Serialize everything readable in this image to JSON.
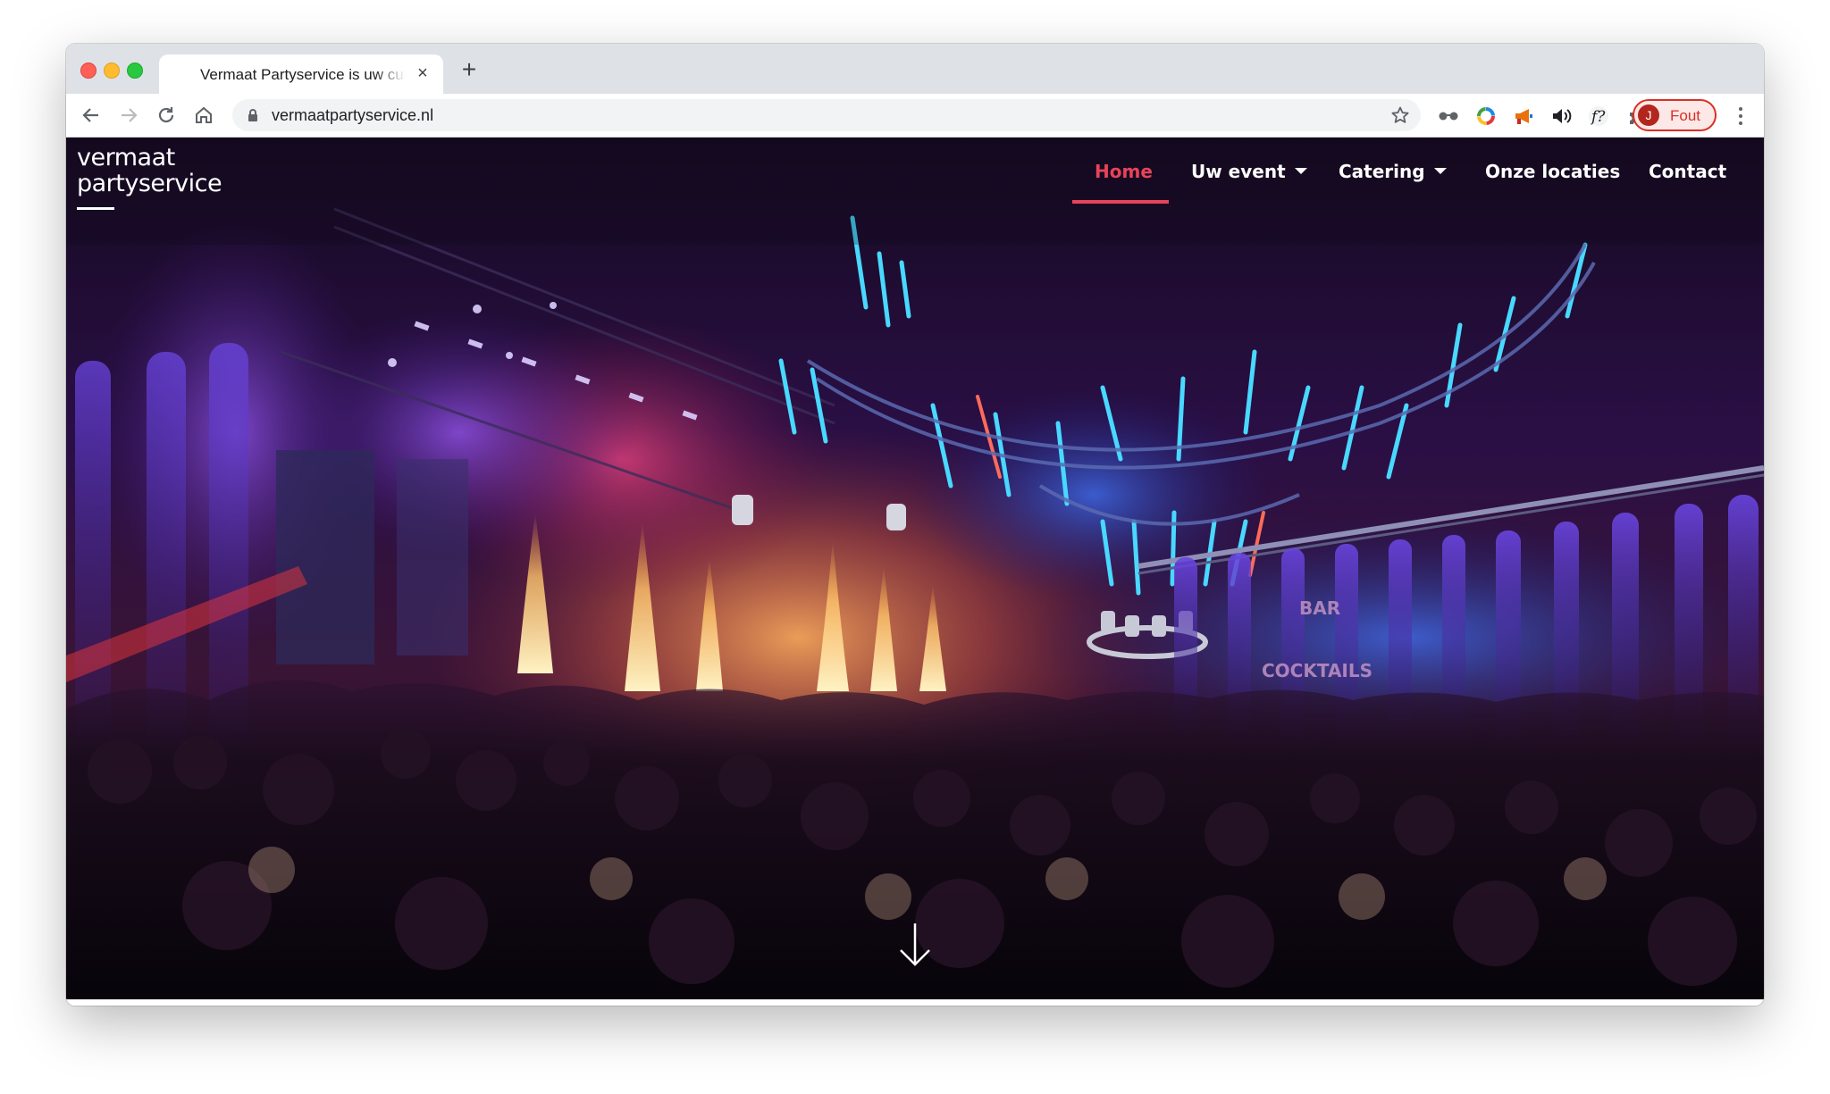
{
  "browser": {
    "tab_title": "Vermaat Partyservice is uw culinaire partner",
    "close_tab_glyph": "×",
    "new_tab_glyph": "+",
    "url": "vermaatpartyservice.nl",
    "profile_initial": "J",
    "profile_status": "Fout",
    "icons": [
      "back-icon",
      "forward-icon",
      "reload-icon",
      "home-icon",
      "lock-icon",
      "star-icon",
      "glasses-extension-icon",
      "color-wheel-extension-icon",
      "megaphone-extension-icon",
      "speaker-extension-icon",
      "font-extension-icon",
      "puzzle-extensions-icon",
      "media-queue-icon",
      "kebab-menu-icon"
    ],
    "colors": {
      "tab_strip": "#dee1e6",
      "profile_error": "#d93025"
    }
  },
  "site": {
    "logo_line1": "vermaat",
    "logo_line2": "partyservice",
    "nav": [
      {
        "label": "Home",
        "active": true
      },
      {
        "label": "Uw event",
        "dropdown": true
      },
      {
        "label": "Catering",
        "dropdown": true
      },
      {
        "label": "Onze locaties"
      },
      {
        "label": "Contact"
      }
    ],
    "hero_image": "Concert hall party: crowd, stage pyrotechnics, blue LED ring rig, BAR and COCKTAILS signs",
    "scroll_icon": "arrow-down-icon",
    "colors": {
      "accent": "#e8435a",
      "nav_text": "#ffffff"
    }
  }
}
